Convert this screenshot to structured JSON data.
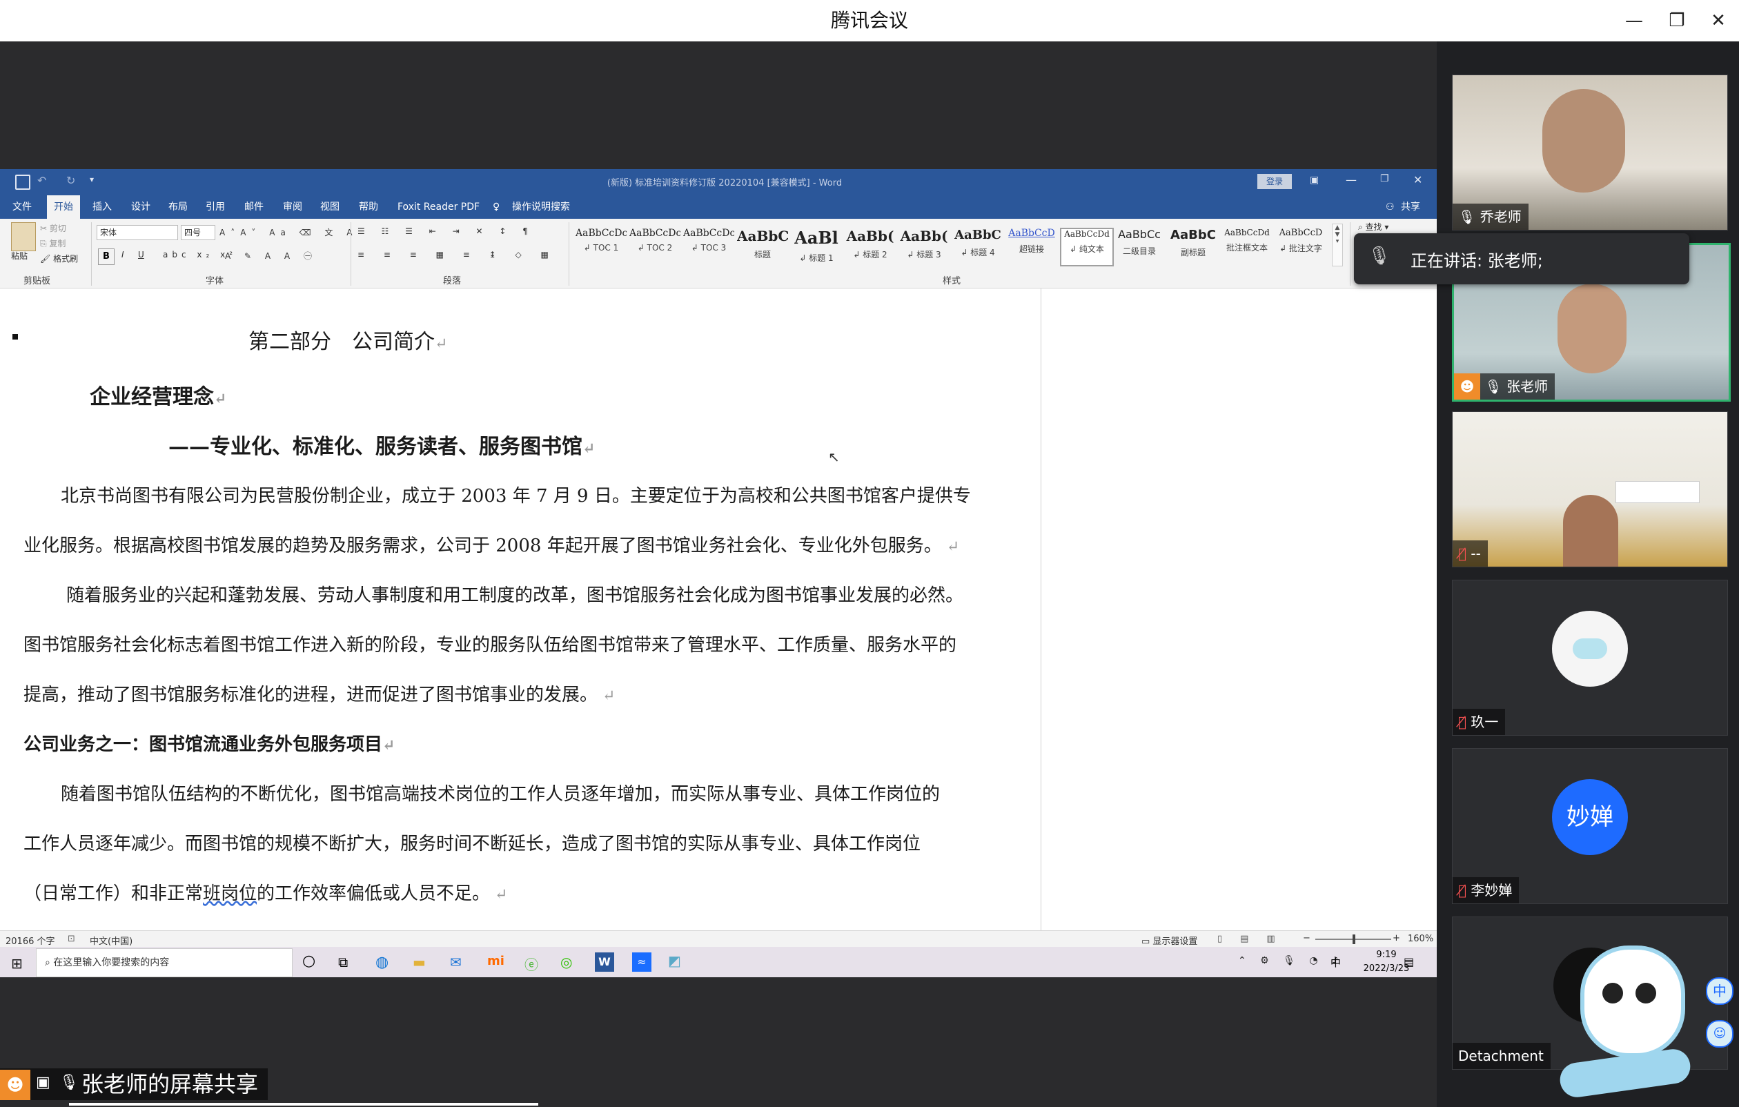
{
  "meeting": {
    "window_title": "腾讯会议",
    "share_label": "张老师的屏幕共享",
    "speaking_label": "正在讲话: 张老师;"
  },
  "word": {
    "doc_title": "(新版) 标准培训资料修订版 20220104 [兼容模式] - Word",
    "login_btn": "登录",
    "menu": [
      "文件",
      "开始",
      "插入",
      "设计",
      "布局",
      "引用",
      "邮件",
      "审阅",
      "视图",
      "帮助",
      "Foxit Reader PDF",
      "操作说明搜索"
    ],
    "share_btn": "共享",
    "find_btn": "查找",
    "clipboard": {
      "paste": "粘贴",
      "cut": "剪切",
      "copy": "复制",
      "format_painter": "格式刷",
      "group": "剪贴板"
    },
    "font": {
      "name": "宋体",
      "size": "四号",
      "group": "字体"
    },
    "paragraph_group": "段落",
    "styles_group": "样式",
    "styles": [
      {
        "sample": "AaBbCcDc",
        "name": "↲ TOC 1"
      },
      {
        "sample": "AaBbCcDc",
        "name": "↲ TOC 2"
      },
      {
        "sample": "AaBbCcDc",
        "name": "↲ TOC 3"
      },
      {
        "sample": "AaBbC",
        "name": "标题"
      },
      {
        "sample": "AaBl",
        "name": "↲ 标题 1"
      },
      {
        "sample": "AaBb(",
        "name": "↲ 标题 2"
      },
      {
        "sample": "AaBb(",
        "name": "↲ 标题 3"
      },
      {
        "sample": "AaBbC",
        "name": "↲ 标题 4"
      },
      {
        "sample": "AaBbCcD",
        "name": "超链接"
      },
      {
        "sample": "AaBbCcDd",
        "name": "↲ 纯文本"
      },
      {
        "sample": "AaBbCc",
        "name": "二级目录"
      },
      {
        "sample": "AaBbC",
        "name": "副标题"
      },
      {
        "sample": "AaBbCcDd",
        "name": "批注框文本"
      },
      {
        "sample": "AaBbCcD",
        "name": "↲ 批注文字"
      }
    ],
    "document": {
      "heading": "第二部分　公司简介",
      "subheading": "企业经营理念",
      "slogan": "——专业化、标准化、服务读者、服务图书馆",
      "p1_l1": "北京书尚图书有限公司为民营股份制企业，成立于 2003 年 7 月 9 日。主要定位于为高校和公共图书馆客户提供专",
      "p1_l2": "业化服务。根据高校图书馆发展的趋势及服务需求，公司于 2008 年起开展了图书馆业务社会化、专业化外包服务。",
      "p2_l1": "随着服务业的兴起和蓬勃发展、劳动人事制度和用工制度的改革，图书馆服务社会化成为图书馆事业发展的必然。",
      "p2_l2": "图书馆服务社会化标志着图书馆工作进入新的阶段，专业的服务队伍给图书馆带来了管理水平、工作质量、服务水平的",
      "p2_l3": "提高，推动了图书馆服务标准化的进程，进而促进了图书馆事业的发展。",
      "section_title": "公司业务之一：图书馆流通业务外包服务项目",
      "p3_l1": "随着图书馆队伍结构的不断优化，图书馆高端技术岗位的工作人员逐年增加，而实际从事专业、具体工作岗位的",
      "p3_l2": "工作人员逐年减少。而图书馆的规模不断扩大，服务时间不断延长，造成了图书馆的实际从事专业、具体工作岗位",
      "p3_l3a": "（日常工作）和非正常",
      "p3_l3b": "班岗位",
      "p3_l3c": "的工作效率偏低或人员不足。"
    },
    "status": {
      "words": "20166 个字",
      "lang": "中文(中国)",
      "display_settings": "显示器设置",
      "zoom": "160%"
    }
  },
  "taskbar": {
    "search_placeholder": "在这里输入你要搜索的内容",
    "time": "9:19",
    "date": "2022/3/23",
    "ime": "中"
  },
  "participants": [
    {
      "name": "乔老师",
      "muted": false
    },
    {
      "name": "张老师",
      "muted": false,
      "speaking": true
    },
    {
      "name": "--",
      "muted": true
    },
    {
      "name": "玖一",
      "muted": true
    },
    {
      "name": "李妙婵",
      "muted": true,
      "avatar_text": "妙婵"
    },
    {
      "name": "Detachment",
      "muted": true
    }
  ],
  "colors": {
    "word_blue": "#2b579a",
    "speaking_border": "#2fb36d",
    "avatar_blue": "#1e6bff",
    "tencent_orange": "#f08c2a"
  }
}
